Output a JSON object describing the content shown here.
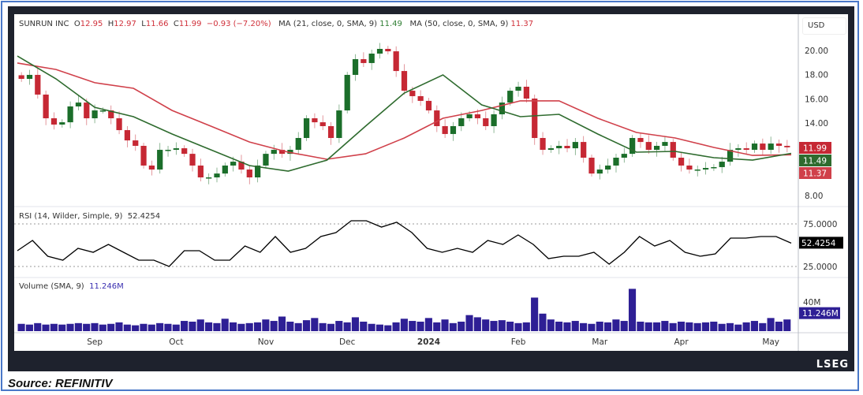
{
  "chart_data": {
    "type": "candlestick",
    "title": "SUNRUN INC",
    "ohlc_last": {
      "open_label": "O",
      "open": "12.95",
      "high_label": "H",
      "high": "12.97",
      "low_label": "L",
      "low": "11.66",
      "close_label": "C",
      "close": "11.99",
      "change": "−0.93 (−7.20%)"
    },
    "currency": "USD",
    "price_ticks": [
      "20.00",
      "18.00",
      "16.00",
      "14.00",
      "8.00"
    ],
    "price_tick_values": [
      20,
      18,
      16,
      14,
      8
    ],
    "ylim": [
      7.3,
      23.0
    ],
    "x_tick_labels": [
      "Sep",
      "Oct",
      "Nov",
      "Dec",
      "2024",
      "Feb",
      "Mar",
      "Apr",
      "May"
    ],
    "x_tick_positions_index": [
      9,
      19,
      30,
      40,
      50,
      61,
      71,
      81,
      92
    ],
    "close": [
      17.65,
      17.98,
      16.35,
      14.39,
      13.87,
      14.06,
      15.37,
      15.69,
      14.39,
      15.04,
      15.04,
      14.39,
      13.41,
      12.56,
      12.11,
      10.48,
      10.15,
      11.78,
      11.78,
      11.91,
      11.45,
      10.48,
      9.5,
      9.5,
      9.82,
      10.48,
      10.8,
      10.15,
      9.5,
      10.48,
      11.45,
      11.78,
      11.45,
      11.78,
      12.76,
      14.39,
      14.06,
      13.74,
      12.76,
      15.04,
      17.98,
      19.28,
      18.96,
      19.74,
      20.13,
      19.93,
      18.3,
      16.67,
      16.22,
      15.83,
      15.04,
      13.74,
      13.09,
      13.74,
      14.39,
      14.72,
      14.39,
      13.74,
      14.72,
      15.69,
      16.67,
      17.0,
      16.02,
      12.76,
      11.78,
      11.91,
      12.11,
      11.91,
      12.43,
      11.13,
      9.82,
      10.15,
      10.48,
      11.13,
      11.45,
      12.76,
      12.43,
      11.78,
      12.11,
      12.43,
      11.13,
      10.48,
      10.15,
      10.15,
      10.28,
      10.35,
      10.8,
      11.78,
      11.91,
      11.78,
      12.3,
      11.78,
      12.3,
      12.11,
      11.99
    ],
    "ma21": {
      "label": "MA (21, close, 0, SMA, 9)",
      "value": "11.49",
      "samples": [
        19.54,
        17.65,
        15.3,
        14.52,
        13.09,
        11.78,
        10.48,
        10.02,
        10.93,
        13.74,
        16.48,
        17.98,
        15.5,
        14.52,
        14.72,
        13.09,
        11.59,
        11.65,
        11.13,
        10.93,
        11.49
      ]
    },
    "ma50": {
      "label": "MA (50, close, 0, SMA, 9)",
      "value": "11.37",
      "samples": [
        18.96,
        18.43,
        17.33,
        16.87,
        15.04,
        13.74,
        12.43,
        11.59,
        11.0,
        11.45,
        12.76,
        14.39,
        15.04,
        15.83,
        15.83,
        14.39,
        13.22,
        12.76,
        11.98,
        11.32,
        11.37
      ]
    },
    "last_price_label": "11.99",
    "rsi": {
      "label": "RSI (14, Wilder, Simple, 9)",
      "value": "52.4254",
      "ticks": [
        "75.0000",
        "25.0000"
      ],
      "upper": 75,
      "lower": 25,
      "ylim": [
        10,
        90
      ],
      "samples": [
        43.5,
        55.6,
        37.0,
        32.4,
        46.3,
        41.7,
        50.9,
        41.7,
        32.4,
        32.4,
        25.0,
        43.5,
        43.5,
        32.4,
        32.4,
        49.1,
        41.7,
        60.2,
        41.7,
        46.3,
        60.2,
        64.8,
        78.7,
        78.7,
        71.3,
        76.9,
        64.8,
        46.3,
        41.7,
        46.3,
        41.7,
        55.6,
        50.9,
        62.0,
        50.9,
        34.3,
        37.0,
        37.0,
        41.7,
        27.8,
        41.7,
        60.2,
        49.1,
        55.6,
        41.7,
        37.0,
        39.8,
        58.3,
        58.3,
        60.2,
        60.2,
        52.4254
      ]
    },
    "volume": {
      "label": "Volume (SMA, 9)",
      "value": "11.246M",
      "ticks": [
        "40M"
      ],
      "tick_values": [
        40
      ],
      "ylim": [
        0,
        62
      ],
      "values_millions": [
        10,
        9,
        11,
        9,
        10,
        9,
        10,
        11,
        10,
        11,
        9,
        10,
        12,
        9,
        8,
        10,
        9,
        11,
        10,
        9,
        14,
        13,
        16,
        12,
        11,
        17,
        12,
        10,
        11,
        12,
        16,
        14,
        20,
        13,
        11,
        15,
        18,
        11,
        10,
        14,
        12,
        19,
        13,
        10,
        9,
        8,
        12,
        17,
        14,
        13,
        18,
        12,
        16,
        11,
        13,
        22,
        19,
        16,
        14,
        15,
        13,
        11,
        12,
        46,
        24,
        16,
        13,
        12,
        14,
        11,
        10,
        13,
        12,
        16,
        14,
        58,
        13,
        12,
        12,
        14,
        11,
        13,
        12,
        11,
        12,
        13,
        10,
        11,
        9,
        12,
        14,
        11,
        18,
        13,
        16
      ]
    },
    "colors": {
      "up": "#1b6e2a",
      "down": "#c62834",
      "ma21": "#2e6b2e",
      "ma50": "#d0404a",
      "rsi": "#000000",
      "volume": "#2e1f95"
    }
  },
  "footer": {
    "brand": "LSEG",
    "source": "Source: REFINITIV"
  }
}
